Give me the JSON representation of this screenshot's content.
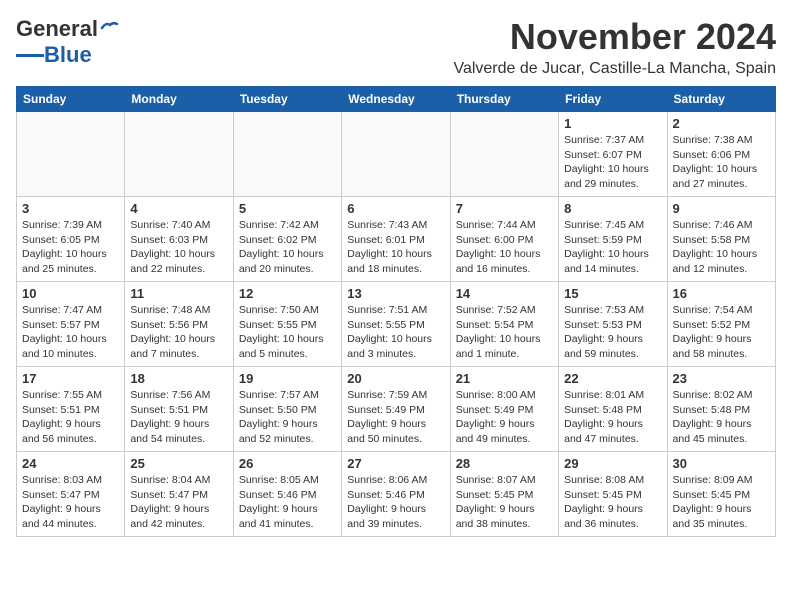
{
  "header": {
    "logo_general": "General",
    "logo_blue": "Blue",
    "month_title": "November 2024",
    "location": "Valverde de Jucar, Castille-La Mancha, Spain"
  },
  "columns": [
    "Sunday",
    "Monday",
    "Tuesday",
    "Wednesday",
    "Thursday",
    "Friday",
    "Saturday"
  ],
  "weeks": [
    [
      {
        "day": "",
        "info": ""
      },
      {
        "day": "",
        "info": ""
      },
      {
        "day": "",
        "info": ""
      },
      {
        "day": "",
        "info": ""
      },
      {
        "day": "",
        "info": ""
      },
      {
        "day": "1",
        "info": "Sunrise: 7:37 AM\nSunset: 6:07 PM\nDaylight: 10 hours and 29 minutes."
      },
      {
        "day": "2",
        "info": "Sunrise: 7:38 AM\nSunset: 6:06 PM\nDaylight: 10 hours and 27 minutes."
      }
    ],
    [
      {
        "day": "3",
        "info": "Sunrise: 7:39 AM\nSunset: 6:05 PM\nDaylight: 10 hours and 25 minutes."
      },
      {
        "day": "4",
        "info": "Sunrise: 7:40 AM\nSunset: 6:03 PM\nDaylight: 10 hours and 22 minutes."
      },
      {
        "day": "5",
        "info": "Sunrise: 7:42 AM\nSunset: 6:02 PM\nDaylight: 10 hours and 20 minutes."
      },
      {
        "day": "6",
        "info": "Sunrise: 7:43 AM\nSunset: 6:01 PM\nDaylight: 10 hours and 18 minutes."
      },
      {
        "day": "7",
        "info": "Sunrise: 7:44 AM\nSunset: 6:00 PM\nDaylight: 10 hours and 16 minutes."
      },
      {
        "day": "8",
        "info": "Sunrise: 7:45 AM\nSunset: 5:59 PM\nDaylight: 10 hours and 14 minutes."
      },
      {
        "day": "9",
        "info": "Sunrise: 7:46 AM\nSunset: 5:58 PM\nDaylight: 10 hours and 12 minutes."
      }
    ],
    [
      {
        "day": "10",
        "info": "Sunrise: 7:47 AM\nSunset: 5:57 PM\nDaylight: 10 hours and 10 minutes."
      },
      {
        "day": "11",
        "info": "Sunrise: 7:48 AM\nSunset: 5:56 PM\nDaylight: 10 hours and 7 minutes."
      },
      {
        "day": "12",
        "info": "Sunrise: 7:50 AM\nSunset: 5:55 PM\nDaylight: 10 hours and 5 minutes."
      },
      {
        "day": "13",
        "info": "Sunrise: 7:51 AM\nSunset: 5:55 PM\nDaylight: 10 hours and 3 minutes."
      },
      {
        "day": "14",
        "info": "Sunrise: 7:52 AM\nSunset: 5:54 PM\nDaylight: 10 hours and 1 minute."
      },
      {
        "day": "15",
        "info": "Sunrise: 7:53 AM\nSunset: 5:53 PM\nDaylight: 9 hours and 59 minutes."
      },
      {
        "day": "16",
        "info": "Sunrise: 7:54 AM\nSunset: 5:52 PM\nDaylight: 9 hours and 58 minutes."
      }
    ],
    [
      {
        "day": "17",
        "info": "Sunrise: 7:55 AM\nSunset: 5:51 PM\nDaylight: 9 hours and 56 minutes."
      },
      {
        "day": "18",
        "info": "Sunrise: 7:56 AM\nSunset: 5:51 PM\nDaylight: 9 hours and 54 minutes."
      },
      {
        "day": "19",
        "info": "Sunrise: 7:57 AM\nSunset: 5:50 PM\nDaylight: 9 hours and 52 minutes."
      },
      {
        "day": "20",
        "info": "Sunrise: 7:59 AM\nSunset: 5:49 PM\nDaylight: 9 hours and 50 minutes."
      },
      {
        "day": "21",
        "info": "Sunrise: 8:00 AM\nSunset: 5:49 PM\nDaylight: 9 hours and 49 minutes."
      },
      {
        "day": "22",
        "info": "Sunrise: 8:01 AM\nSunset: 5:48 PM\nDaylight: 9 hours and 47 minutes."
      },
      {
        "day": "23",
        "info": "Sunrise: 8:02 AM\nSunset: 5:48 PM\nDaylight: 9 hours and 45 minutes."
      }
    ],
    [
      {
        "day": "24",
        "info": "Sunrise: 8:03 AM\nSunset: 5:47 PM\nDaylight: 9 hours and 44 minutes."
      },
      {
        "day": "25",
        "info": "Sunrise: 8:04 AM\nSunset: 5:47 PM\nDaylight: 9 hours and 42 minutes."
      },
      {
        "day": "26",
        "info": "Sunrise: 8:05 AM\nSunset: 5:46 PM\nDaylight: 9 hours and 41 minutes."
      },
      {
        "day": "27",
        "info": "Sunrise: 8:06 AM\nSunset: 5:46 PM\nDaylight: 9 hours and 39 minutes."
      },
      {
        "day": "28",
        "info": "Sunrise: 8:07 AM\nSunset: 5:45 PM\nDaylight: 9 hours and 38 minutes."
      },
      {
        "day": "29",
        "info": "Sunrise: 8:08 AM\nSunset: 5:45 PM\nDaylight: 9 hours and 36 minutes."
      },
      {
        "day": "30",
        "info": "Sunrise: 8:09 AM\nSunset: 5:45 PM\nDaylight: 9 hours and 35 minutes."
      }
    ]
  ]
}
